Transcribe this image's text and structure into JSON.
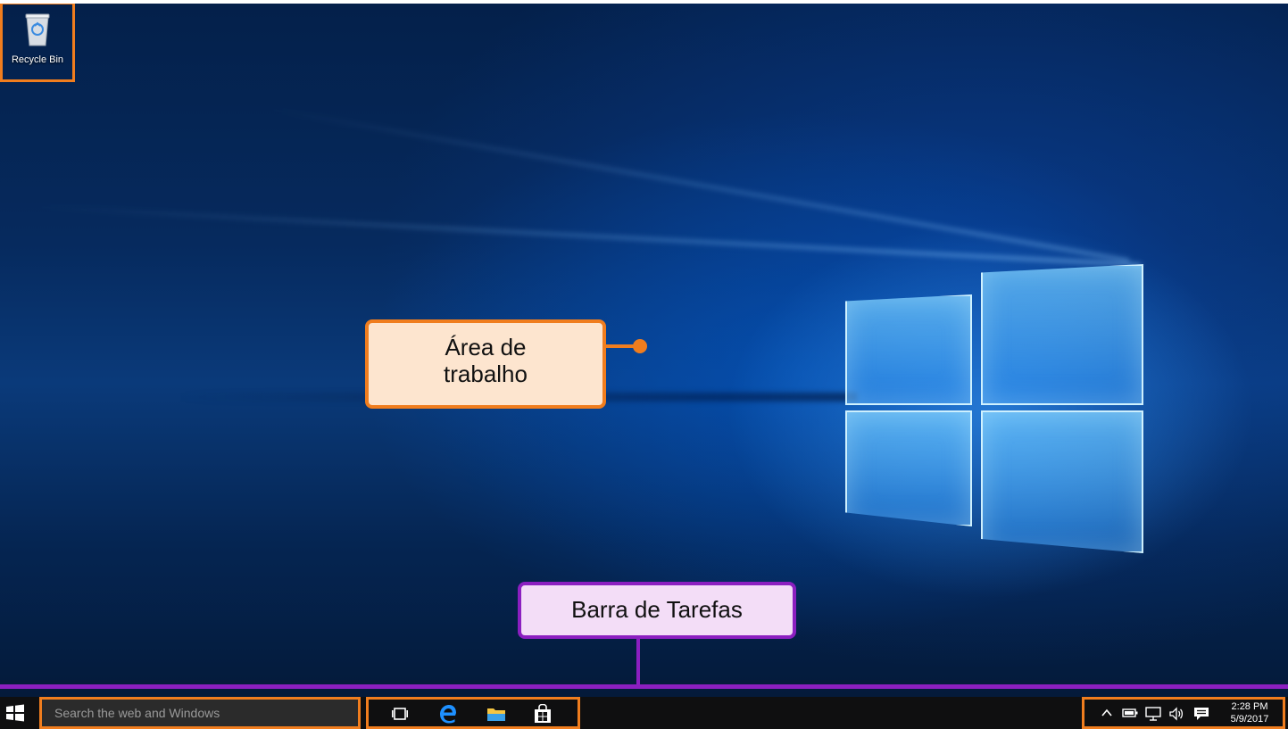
{
  "desktop": {
    "recycle_bin_label": "Recycle Bin"
  },
  "callouts": {
    "desktop_line1": "Área de",
    "desktop_line2": "trabalho",
    "taskbar": "Barra de Tarefas"
  },
  "taskbar": {
    "search_placeholder": "Search the web and Windows",
    "clock_time": "2:28 PM",
    "clock_date": "5/9/2017",
    "pinned_icons": [
      "task-view-icon",
      "edge-icon",
      "file-explorer-icon",
      "store-icon"
    ],
    "tray_icons": [
      "chevron-up-icon",
      "battery-icon",
      "network-icon",
      "volume-icon",
      "action-center-icon"
    ]
  },
  "colors": {
    "highlight_orange": "#f07d1e",
    "highlight_purple": "#8b1fc0",
    "callout_orange_fill": "#fde5cf",
    "callout_purple_fill": "#f3ddf7",
    "taskbar_bg": "#0f0f10"
  }
}
